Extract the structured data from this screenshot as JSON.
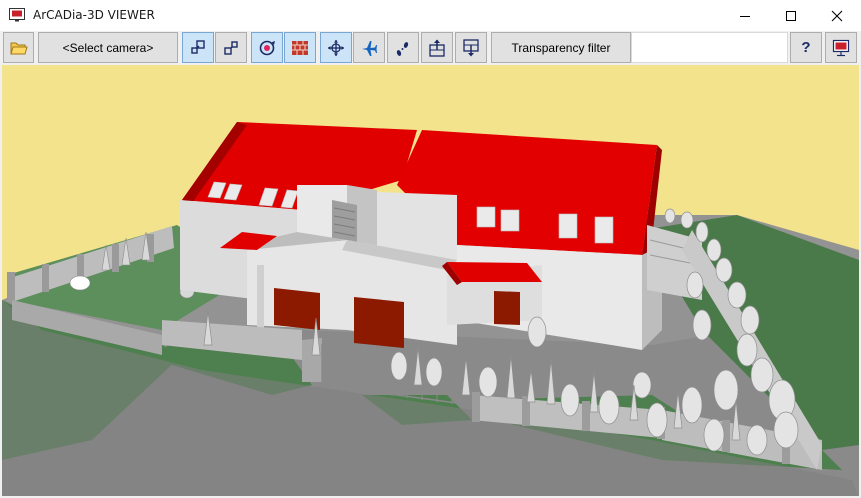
{
  "window": {
    "title": "ArCADia-3D VIEWER",
    "controls": [
      "minimize",
      "maximize",
      "close"
    ]
  },
  "toolbar": {
    "camera_label": "<Select camera>",
    "transparency_label": "Transparency filter",
    "help_label": "?",
    "transparency_value": "",
    "buttons": [
      {
        "icon": "open-folder-icon",
        "active": false
      },
      {
        "icon": "zoom-in-icon",
        "active": true
      },
      {
        "icon": "zoom-out-icon",
        "active": false
      },
      {
        "icon": "orbit-icon",
        "active": true
      },
      {
        "icon": "walls-icon",
        "active": true
      },
      {
        "icon": "move-icon",
        "active": true
      },
      {
        "icon": "fly-icon",
        "active": false
      },
      {
        "icon": "walk-icon",
        "active": false
      },
      {
        "icon": "level-up-icon",
        "active": false
      },
      {
        "icon": "level-down-icon",
        "active": false
      },
      {
        "icon": "presentation-icon",
        "active": false
      }
    ]
  },
  "colors": {
    "viewport_bg": "#f3e38d",
    "roof": "#e00000",
    "walls": "#e6e6e6",
    "grass": "#4a7a4a",
    "ground": "#8f8f8f",
    "active_button": "#cce4f7"
  },
  "viewport": {
    "scene": "3d-house-model"
  }
}
